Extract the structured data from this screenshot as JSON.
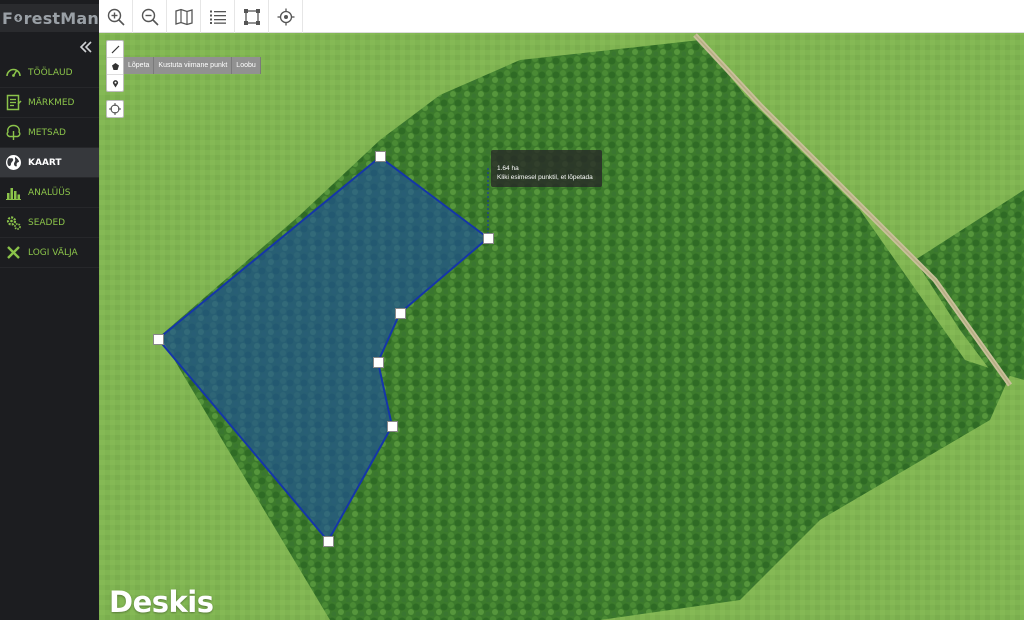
{
  "app": {
    "logo_text": "FrestMan",
    "logo_prefix": "F",
    "logo_suffix": "restMan"
  },
  "sidebar": {
    "items": [
      {
        "label": "TÖÖLAUD",
        "icon": "dashboard-icon"
      },
      {
        "label": "MÄRKMED",
        "icon": "notes-icon"
      },
      {
        "label": "METSAD",
        "icon": "tree-icon"
      },
      {
        "label": "KAART",
        "icon": "globe-icon",
        "active": true
      },
      {
        "label": "ANALÜÜS",
        "icon": "bar-chart-icon"
      },
      {
        "label": "SEADED",
        "icon": "gear-icon"
      },
      {
        "label": "LOGI VÄLJA",
        "icon": "close-icon"
      }
    ]
  },
  "toolbar": {
    "buttons": [
      "zoom-in-icon",
      "zoom-out-icon",
      "map-icon",
      "list-icon",
      "select-area-icon",
      "locate-icon"
    ]
  },
  "draw": {
    "actions": {
      "finish": "Lõpeta",
      "delete_last": "Kustuta viimane punkt",
      "cancel": "Loobu"
    }
  },
  "tooltip": {
    "area": "1.64 ha",
    "hint": "Kliki esimesel punktil, et lõpetada"
  },
  "watermark": "Deskis",
  "colors": {
    "accent": "#8bc34a",
    "sidebar_bg": "#1c1d20",
    "polygon_fill": "#1d4fa0",
    "polygon_stroke": "#1536a8"
  }
}
